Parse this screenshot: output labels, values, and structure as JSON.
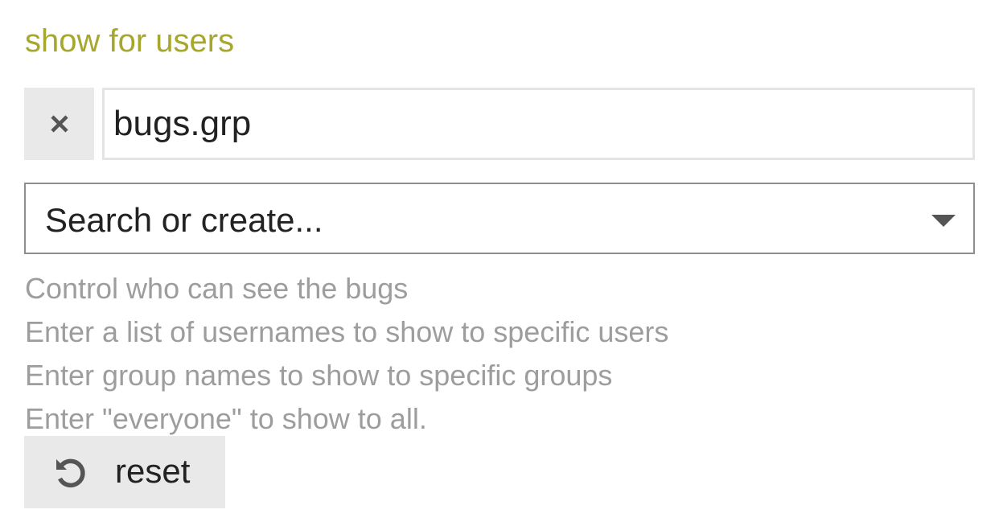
{
  "setting": {
    "title": "show for users",
    "title_color": "#a6a82e"
  },
  "values": [
    {
      "text": "bugs.grp",
      "remove_icon": "close-icon"
    }
  ],
  "search": {
    "placeholder": "Search or create...",
    "dropdown_icon": "caret-down-icon"
  },
  "description": {
    "lines": [
      "Control who can see the bugs",
      "Enter a list of usernames to show to specific users",
      "Enter group names to show to specific groups",
      "Enter \"everyone\" to show to all."
    ]
  },
  "reset_button": {
    "label": "reset",
    "icon": "undo-icon"
  }
}
